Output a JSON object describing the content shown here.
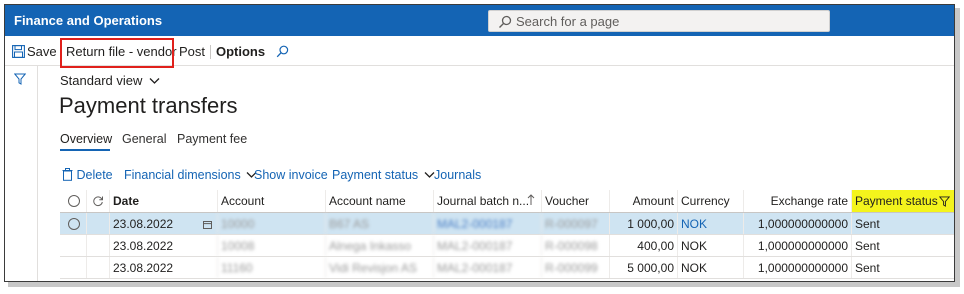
{
  "app": {
    "title": "Finance and Operations"
  },
  "search": {
    "placeholder": "Search for a page"
  },
  "actions": {
    "save": "Save",
    "return_file": "Return file - vendor",
    "post": "Post",
    "options": "Options"
  },
  "view": {
    "label": "Standard view"
  },
  "page": {
    "title": "Payment transfers"
  },
  "tabs": [
    "Overview",
    "General",
    "Payment fee"
  ],
  "toolbar": {
    "delete": "Delete",
    "financial_dimensions": "Financial dimensions",
    "show_invoice": "Show invoice",
    "payment_status": "Payment status",
    "journals": "Journals"
  },
  "columns": {
    "date": "Date",
    "account": "Account",
    "account_name": "Account name",
    "journal_batch": "Journal batch n...",
    "voucher": "Voucher",
    "amount": "Amount",
    "currency": "Currency",
    "exchange_rate": "Exchange rate",
    "payment_status": "Payment status"
  },
  "rows": [
    {
      "date": "23.08.2022",
      "account": "10000",
      "account_name": "B67 AS",
      "journal_batch": "MAL2-000187",
      "voucher": "R-000097",
      "amount": "1 000,00",
      "currency": "NOK",
      "exchange_rate": "1,000000000000",
      "payment_status": "Sent"
    },
    {
      "date": "23.08.2022",
      "account": "10008",
      "account_name": "Alnega Inkasso",
      "journal_batch": "MAL2-000187",
      "voucher": "R-000098",
      "amount": "400,00",
      "currency": "NOK",
      "exchange_rate": "1,000000000000",
      "payment_status": "Sent"
    },
    {
      "date": "23.08.2022",
      "account": "11160",
      "account_name": "Vidi Revisjon AS",
      "journal_batch": "MAL2-000187",
      "voucher": "R-000099",
      "amount": "5 000,00",
      "currency": "NOK",
      "exchange_rate": "1,000000000000",
      "payment_status": "Sent"
    }
  ],
  "colors": {
    "topbar": "#1464b4",
    "highlight_box": "#e0201b",
    "payment_status_highlight": "#f4f41c",
    "selected_row": "#cfe4f2"
  }
}
